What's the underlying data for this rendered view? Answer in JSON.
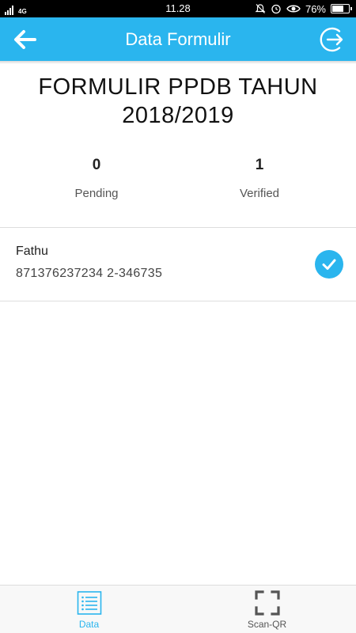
{
  "status_bar": {
    "network_label": "4G",
    "time": "11.28",
    "battery_percent": "76%",
    "battery_level": 0.76,
    "icons": [
      "signal-icon",
      "silent-icon",
      "alarm-icon",
      "eye-icon",
      "battery-icon"
    ]
  },
  "app_bar": {
    "title": "Data Formulir",
    "back_icon": "arrow-left-icon",
    "logout_icon": "logout-icon",
    "color": "#2ab5ee"
  },
  "form": {
    "title": "FORMULIR PPDB TAHUN 2018/2019"
  },
  "stats": {
    "pending_count": "0",
    "pending_label": "Pending",
    "verified_count": "1",
    "verified_label": "Verified"
  },
  "entries": [
    {
      "name": "Fathu",
      "detail": "871376237234 2-346735",
      "status_icon": "check-circle-icon"
    }
  ],
  "bottom_nav": {
    "items": [
      {
        "label": "Data",
        "icon": "list-icon",
        "active": true
      },
      {
        "label": "Scan-QR",
        "icon": "scan-qr-icon",
        "active": false
      }
    ],
    "active_color": "#2ab5ee"
  }
}
